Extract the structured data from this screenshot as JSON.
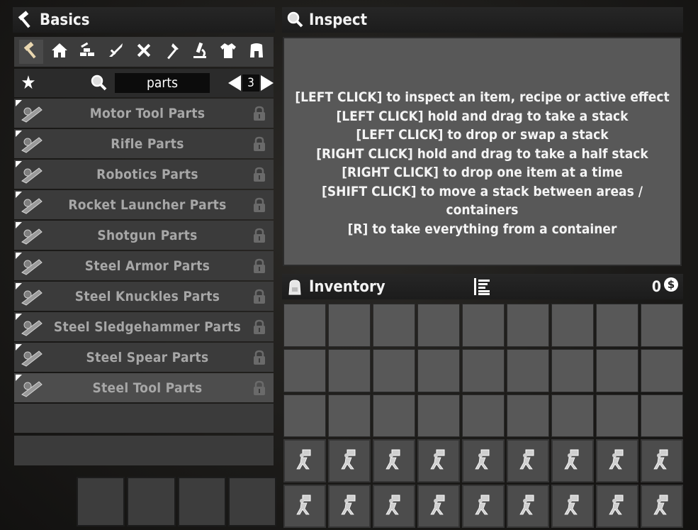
{
  "basics": {
    "title": "Basics"
  },
  "categories": [
    {
      "id": "all",
      "icon": "hammer-icon",
      "active": true
    },
    {
      "id": "building",
      "icon": "house-icon"
    },
    {
      "id": "resources",
      "icon": "bricks-icon"
    },
    {
      "id": "weapons",
      "icon": "weapon-icon"
    },
    {
      "id": "tools",
      "icon": "tools-icon"
    },
    {
      "id": "food",
      "icon": "fork-icon"
    },
    {
      "id": "science",
      "icon": "microscope-icon"
    },
    {
      "id": "clothing",
      "icon": "shirt-icon"
    },
    {
      "id": "armor",
      "icon": "armor-icon"
    }
  ],
  "search": {
    "value": "parts",
    "page": "3"
  },
  "recipes": [
    {
      "name": "Motor Tool Parts",
      "icon": "motor-tool-parts-icon",
      "locked": true
    },
    {
      "name": "Rifle Parts",
      "icon": "rifle-parts-icon",
      "locked": true
    },
    {
      "name": "Robotics Parts",
      "icon": "robotics-parts-icon",
      "locked": true
    },
    {
      "name": "Rocket Launcher Parts",
      "icon": "rocket-launcher-parts-icon",
      "locked": true
    },
    {
      "name": "Shotgun Parts",
      "icon": "shotgun-parts-icon",
      "locked": true
    },
    {
      "name": "Steel Armor Parts",
      "icon": "steel-armor-parts-icon",
      "locked": true
    },
    {
      "name": "Steel Knuckles Parts",
      "icon": "steel-knuckles-parts-icon",
      "locked": true
    },
    {
      "name": "Steel Sledgehammer Parts",
      "icon": "steel-sledgehammer-parts-icon",
      "locked": true
    },
    {
      "name": "Steel Spear Parts",
      "icon": "steel-spear-parts-icon",
      "locked": true
    },
    {
      "name": "Steel Tool Parts",
      "icon": "steel-tool-parts-icon",
      "locked": true,
      "selected": true
    }
  ],
  "inspect": {
    "title": "Inspect",
    "lines": [
      "[LEFT CLICK] to inspect an item, recipe or active effect",
      "[LEFT CLICK] hold and drag to take a stack",
      "[LEFT CLICK] to drop or swap a stack",
      "[RIGHT CLICK] hold and drag to take a half stack",
      "[RIGHT CLICK] to drop one item at a time",
      "[SHIFT CLICK] to move a stack between areas / containers",
      "[R] to take everything from a container"
    ]
  },
  "inventory": {
    "title": "Inventory",
    "coins": "0",
    "sort_icon": "sort-icon",
    "currency_icon": "dukes-coin-icon",
    "rows": 5,
    "cols": 9,
    "open_rows": 3,
    "locked_slot_icon": "encumbered-icon"
  },
  "crafting_queue": {
    "slots": 4
  },
  "colors": {
    "panel": "#585858",
    "row": "#3b3b3b",
    "row_selected": "#4d4d4d",
    "recipe_text": "#a7a7a7"
  }
}
